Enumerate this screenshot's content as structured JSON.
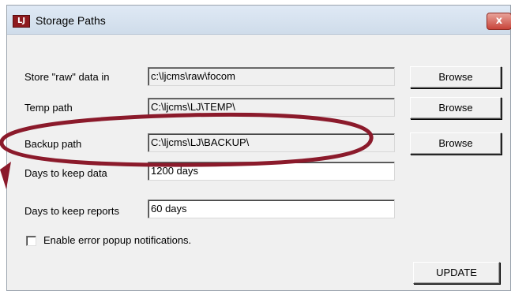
{
  "window": {
    "title": "Storage Paths",
    "icon_label": "LJ",
    "close_label": "x"
  },
  "fields": [
    {
      "label": "Store \"raw\" data in",
      "value": "c:\\ljcms\\raw\\focom",
      "browse_label": "Browse"
    },
    {
      "label": "Temp path",
      "value": "C:\\ljcms\\LJ\\TEMP\\",
      "browse_label": "Browse"
    },
    {
      "label": "Backup path",
      "value": "C:\\ljcms\\LJ\\BACKUP\\",
      "browse_label": "Browse"
    }
  ],
  "retention": [
    {
      "label": "Days to keep data",
      "value": "1200 days"
    },
    {
      "label": "Days to keep reports",
      "value": "60 days"
    }
  ],
  "options": {
    "error_popup_label": "Enable error popup notifications.",
    "error_popup_checked": false
  },
  "actions": {
    "update_label": "UPDATE"
  },
  "annotation": {
    "color": "#8b1a2b",
    "target": "backup-path"
  }
}
